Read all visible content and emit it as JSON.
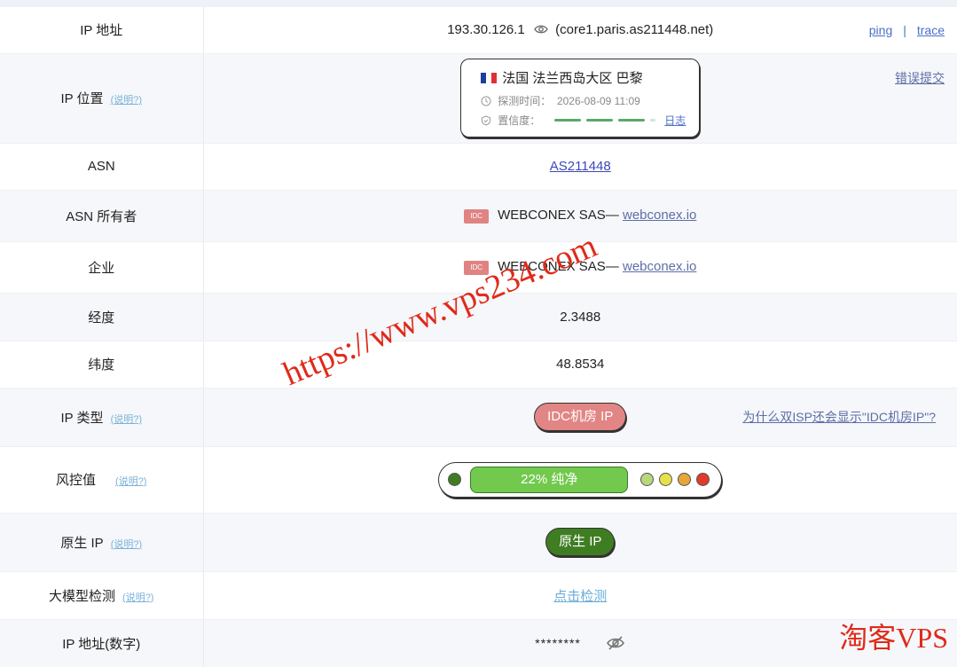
{
  "rows": {
    "ip": {
      "label": "IP 地址",
      "address": "193.30.126.1",
      "hostname": "(core1.paris.as211448.net)",
      "ping": "ping",
      "sep": "|",
      "trace": "trace"
    },
    "location": {
      "label": "IP 位置",
      "hint": "(说明?)",
      "place": "法国 法兰西岛大区 巴黎",
      "time_label": "探测时间：",
      "time_value": "2026-08-09 11:09",
      "conf_label": "置信度：",
      "conf_level": 0.85,
      "log": "日志",
      "report": "错误提交"
    },
    "asn": {
      "label": "ASN",
      "value": "AS211448"
    },
    "asn_owner": {
      "label": "ASN 所有者",
      "badge": "IDC",
      "name": "WEBCONEX SAS—",
      "domain": "webconex.io"
    },
    "company": {
      "label": "企业",
      "badge": "IDC",
      "name": "WEBCONEX SAS—",
      "domain": "webconex.io"
    },
    "longitude": {
      "label": "经度",
      "value": "2.3488"
    },
    "latitude": {
      "label": "纬度",
      "value": "48.8534"
    },
    "ip_type": {
      "label": "IP 类型",
      "hint": "(说明?)",
      "value": "IDC机房 IP",
      "why": "为什么双ISP还会显示\"IDC机房IP\"?"
    },
    "risk": {
      "label": "风控值",
      "hint": "(说明?)",
      "text": "22%  纯净",
      "percent": 22
    },
    "native": {
      "label": "原生 IP",
      "hint": "(说明?)",
      "value": "原生 IP"
    },
    "llm": {
      "label": "大模型检测",
      "hint": "(说明?)",
      "value": "点击检测"
    },
    "ip_numeric": {
      "label": "IP 地址(数字)",
      "value": "********"
    }
  },
  "colors": {
    "risk_low": "#3f7d22",
    "risk_bar": "#72c94d",
    "idc": "#e28585",
    "native": "#3f7d22",
    "dots": [
      "#b9d67a",
      "#e6e04a",
      "#e6a63a",
      "#e03a2a"
    ]
  },
  "watermarks": {
    "diagonal": "https://www.vps234.com",
    "corner": "淘客VPS"
  }
}
